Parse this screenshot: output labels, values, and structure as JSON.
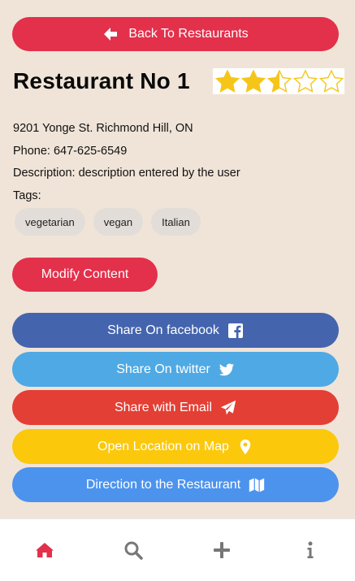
{
  "header": {
    "back_label": "Back To Restaurants"
  },
  "restaurant": {
    "name": "Restaurant No 1",
    "rating": 2.5,
    "rating_max": 5,
    "address": "9201 Yonge St. Richmond Hill, ON",
    "phone_line": "Phone: 647-625-6549",
    "description_line": "Description: description entered by the user",
    "tags_label": "Tags:",
    "tags": [
      "vegetarian",
      "vegan",
      "Italian"
    ]
  },
  "modify_label": "Modify Content",
  "actions": {
    "facebook": "Share On facebook",
    "twitter": "Share On twitter",
    "email": "Share with Email",
    "map": "Open Location on Map",
    "direction": "Direction to the Restaurant"
  },
  "tabbar": {
    "active_color": "#e3304b",
    "inactive_color": "#777777",
    "items": [
      "home-icon",
      "search-icon",
      "plus-icon",
      "info-icon"
    ]
  },
  "colors": {
    "background": "#f0e4d8",
    "primary": "#e3304b",
    "facebook": "#4464ae",
    "twitter": "#4fa9e4",
    "email": "#e33f35",
    "map": "#fbc80c",
    "direction": "#4c93ee",
    "star": "#f5c518"
  }
}
